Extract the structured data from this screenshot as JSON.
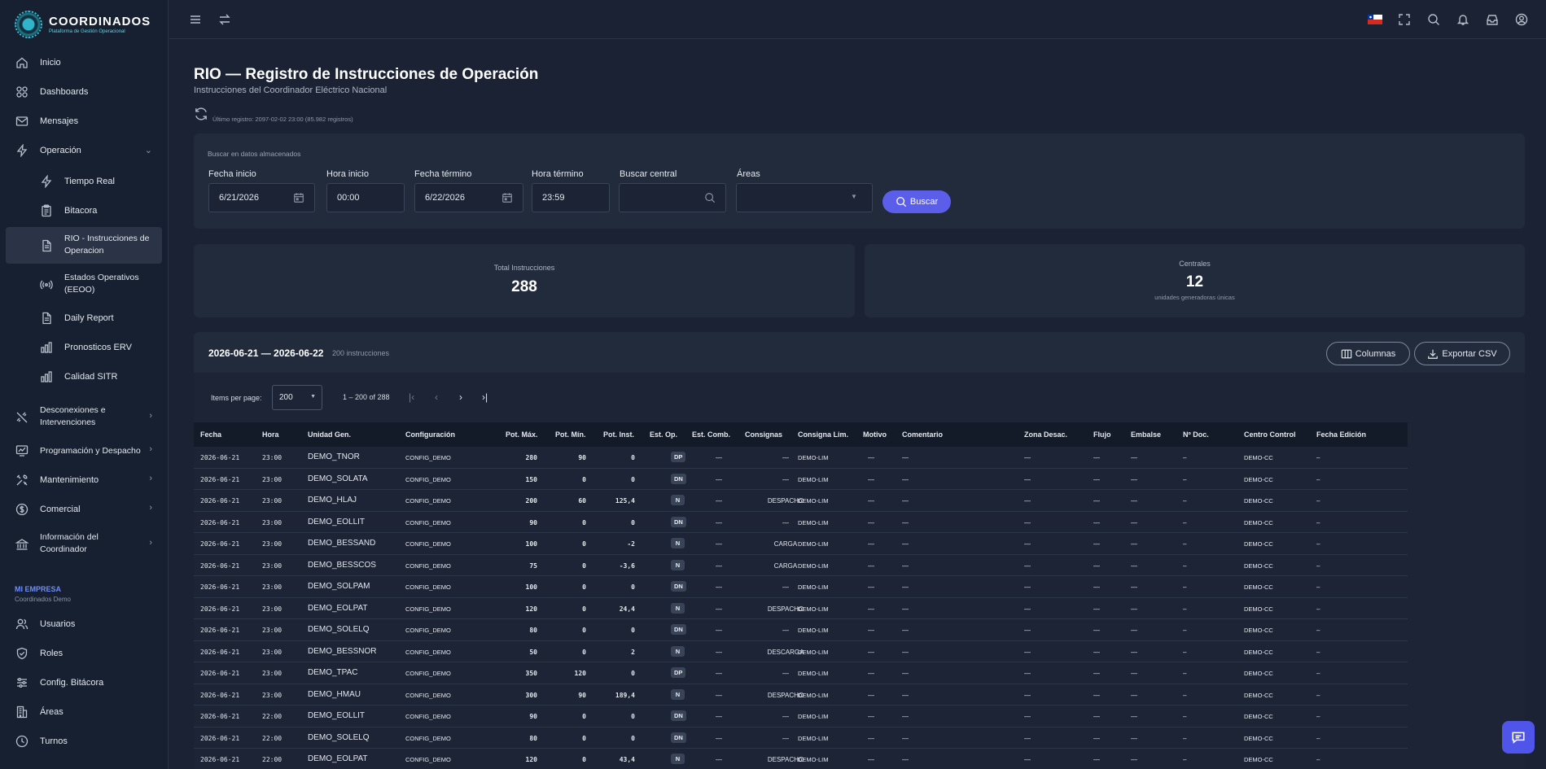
{
  "brand": {
    "name": "COORDINADOS",
    "subtitle": "Plataforma de Gestión Operacional"
  },
  "nav": {
    "inicio": "Inicio",
    "dashboards": "Dashboards",
    "mensajes": "Mensajes",
    "operacion": "Operación",
    "tiempo_real": "Tiempo Real",
    "bitacora": "Bitacora",
    "rio_line1": "RIO - Instrucciones de",
    "rio_line2": "Operacion",
    "estados_line1": "Estados Operativos",
    "estados_line2": "(EEOO)",
    "daily_report": "Daily Report",
    "pronosticos": "Pronosticos ERV",
    "calidad": "Calidad SITR",
    "desconexiones_line1": "Desconexiones e",
    "desconexiones_line2": "Intervenciones",
    "programacion": "Programación y Despacho",
    "mantenimiento": "Mantenimiento",
    "comercial": "Comercial",
    "informacion_line1": "Información del",
    "informacion_line2": "Coordinador",
    "section_title": "MI EMPRESA",
    "section_sub": "Coordinados Demo",
    "usuarios": "Usuarios",
    "roles": "Roles",
    "config_bitacora": "Config. Bitácora",
    "areas": "Áreas",
    "turnos": "Turnos"
  },
  "page": {
    "title": "RIO — Registro de Instrucciones de Operación",
    "subtitle": "Instrucciones del Coordinador Eléctrico Nacional",
    "last_record": "Último registro: 2097-02-02 23:00 (85.982 registros)"
  },
  "search": {
    "title": "Buscar en datos almacenados",
    "fecha_inicio_label": "Fecha inicio",
    "fecha_inicio_value": "6/21/2026",
    "hora_inicio_label": "Hora inicio",
    "hora_inicio_value": "00:00",
    "fecha_termino_label": "Fecha término",
    "fecha_termino_value": "6/22/2026",
    "hora_termino_label": "Hora término",
    "hora_termino_value": "23:59",
    "central_label": "Buscar central",
    "central_value": "",
    "areas_label": "Áreas",
    "areas_value": "",
    "button": "Buscar"
  },
  "stats": {
    "total_label": "Total Instrucciones",
    "total_value": "288",
    "centrales_label": "Centrales",
    "centrales_value": "12",
    "centrales_sub": "unidades generadoras únicas"
  },
  "results": {
    "range": "2026-06-21 — 2026-06-22",
    "count": "200 instrucciones",
    "columns_button": "Columnas",
    "export_button": "Exportar CSV",
    "items_per_page_label": "Items per page:",
    "items_per_page_value": "200",
    "page_range": "1 – 200 of 288"
  },
  "table": {
    "headers": [
      "Fecha",
      "Hora",
      "Unidad Gen.",
      "Configuración",
      "Pot. Máx.",
      "Pot. Mín.",
      "Pot. Inst.",
      "Est. Op.",
      "Est. Comb.",
      "Consignas",
      "Consigna Lim.",
      "Motivo",
      "Comentario",
      "Zona Desac.",
      "Flujo",
      "Embalse",
      "Nº Doc.",
      "Centro Control",
      "Fecha Edición"
    ],
    "rows": [
      [
        "2026-06-21",
        "23:00",
        "DEMO_TNOR",
        "CONFIG_DEMO",
        "280",
        "90",
        "0",
        "DP",
        "—",
        "—",
        "DEMO-LIM",
        "—",
        "—",
        "—",
        "—",
        "—",
        "–",
        "DEMO-CC",
        "–"
      ],
      [
        "2026-06-21",
        "23:00",
        "DEMO_SOLATA",
        "CONFIG_DEMO",
        "150",
        "0",
        "0",
        "DN",
        "—",
        "—",
        "DEMO-LIM",
        "—",
        "—",
        "—",
        "—",
        "—",
        "–",
        "DEMO-CC",
        "–"
      ],
      [
        "2026-06-21",
        "23:00",
        "DEMO_HLAJ",
        "CONFIG_DEMO",
        "200",
        "60",
        "125,4",
        "N",
        "—",
        "DESPACHO",
        "DEMO-LIM",
        "—",
        "—",
        "—",
        "—",
        "—",
        "–",
        "DEMO-CC",
        "–"
      ],
      [
        "2026-06-21",
        "23:00",
        "DEMO_EOLLIT",
        "CONFIG_DEMO",
        "90",
        "0",
        "0",
        "DN",
        "—",
        "—",
        "DEMO-LIM",
        "—",
        "—",
        "—",
        "—",
        "—",
        "–",
        "DEMO-CC",
        "–"
      ],
      [
        "2026-06-21",
        "23:00",
        "DEMO_BESSAND",
        "CONFIG_DEMO",
        "100",
        "0",
        "-2",
        "N",
        "—",
        "CARGA",
        "DEMO-LIM",
        "—",
        "—",
        "—",
        "—",
        "—",
        "–",
        "DEMO-CC",
        "–"
      ],
      [
        "2026-06-21",
        "23:00",
        "DEMO_BESSCOS",
        "CONFIG_DEMO",
        "75",
        "0",
        "-3,6",
        "N",
        "—",
        "CARGA",
        "DEMO-LIM",
        "—",
        "—",
        "—",
        "—",
        "—",
        "–",
        "DEMO-CC",
        "–"
      ],
      [
        "2026-06-21",
        "23:00",
        "DEMO_SOLPAM",
        "CONFIG_DEMO",
        "100",
        "0",
        "0",
        "DN",
        "—",
        "—",
        "DEMO-LIM",
        "—",
        "—",
        "—",
        "—",
        "—",
        "–",
        "DEMO-CC",
        "–"
      ],
      [
        "2026-06-21",
        "23:00",
        "DEMO_EOLPAT",
        "CONFIG_DEMO",
        "120",
        "0",
        "24,4",
        "N",
        "—",
        "DESPACHO",
        "DEMO-LIM",
        "—",
        "—",
        "—",
        "—",
        "—",
        "–",
        "DEMO-CC",
        "–"
      ],
      [
        "2026-06-21",
        "23:00",
        "DEMO_SOLELQ",
        "CONFIG_DEMO",
        "80",
        "0",
        "0",
        "DN",
        "—",
        "—",
        "DEMO-LIM",
        "—",
        "—",
        "—",
        "—",
        "—",
        "–",
        "DEMO-CC",
        "–"
      ],
      [
        "2026-06-21",
        "23:00",
        "DEMO_BESSNOR",
        "CONFIG_DEMO",
        "50",
        "0",
        "2",
        "N",
        "—",
        "DESCARGA",
        "DEMO-LIM",
        "—",
        "—",
        "—",
        "—",
        "—",
        "–",
        "DEMO-CC",
        "–"
      ],
      [
        "2026-06-21",
        "23:00",
        "DEMO_TPAC",
        "CONFIG_DEMO",
        "350",
        "120",
        "0",
        "DP",
        "—",
        "—",
        "DEMO-LIM",
        "—",
        "—",
        "—",
        "—",
        "—",
        "–",
        "DEMO-CC",
        "–"
      ],
      [
        "2026-06-21",
        "23:00",
        "DEMO_HMAU",
        "CONFIG_DEMO",
        "300",
        "90",
        "189,4",
        "N",
        "—",
        "DESPACHO",
        "DEMO-LIM",
        "—",
        "—",
        "—",
        "—",
        "—",
        "–",
        "DEMO-CC",
        "–"
      ],
      [
        "2026-06-21",
        "22:00",
        "DEMO_EOLLIT",
        "CONFIG_DEMO",
        "90",
        "0",
        "0",
        "DN",
        "—",
        "—",
        "DEMO-LIM",
        "—",
        "—",
        "—",
        "—",
        "—",
        "–",
        "DEMO-CC",
        "–"
      ],
      [
        "2026-06-21",
        "22:00",
        "DEMO_SOLELQ",
        "CONFIG_DEMO",
        "80",
        "0",
        "0",
        "DN",
        "—",
        "—",
        "DEMO-LIM",
        "—",
        "—",
        "—",
        "—",
        "—",
        "–",
        "DEMO-CC",
        "–"
      ],
      [
        "2026-06-21",
        "22:00",
        "DEMO_EOLPAT",
        "CONFIG_DEMO",
        "120",
        "0",
        "43,4",
        "N",
        "—",
        "DESPACHO",
        "DEMO-LIM",
        "—",
        "—",
        "—",
        "—",
        "—",
        "–",
        "DEMO-CC",
        "–"
      ]
    ]
  },
  "colors": {
    "accent": "#5b5ee8",
    "sidebar_bg": "#172030",
    "main_bg": "#1a2233",
    "card_bg": "#222b3c"
  }
}
